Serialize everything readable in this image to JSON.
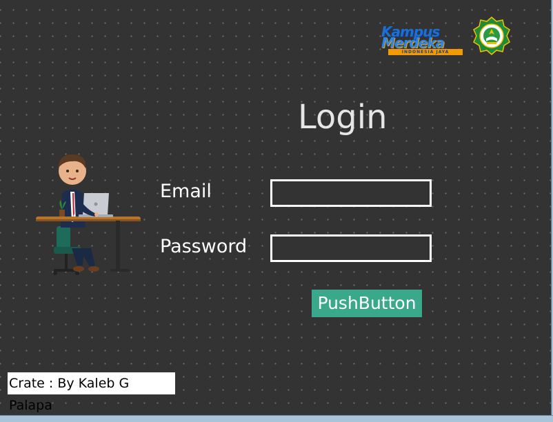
{
  "logos": {
    "kampus_merdeka": {
      "line1": "Kampus",
      "line2": "Merdeka",
      "strip": "INDONESIA JAYA"
    },
    "university_emblem": {
      "icon": "university-emblem-icon"
    }
  },
  "login": {
    "title": "Login",
    "email_label": "Email",
    "password_label": "Password",
    "email_value": "",
    "password_value": "",
    "button_label": "PushButton"
  },
  "footer": {
    "credit": "Crate : By Kaleb G Palapa"
  },
  "colors": {
    "background": "#333333",
    "button": "#3aa88b",
    "text": "#ffffff"
  },
  "illustration": {
    "icon": "businessman-at-laptop-icon"
  }
}
